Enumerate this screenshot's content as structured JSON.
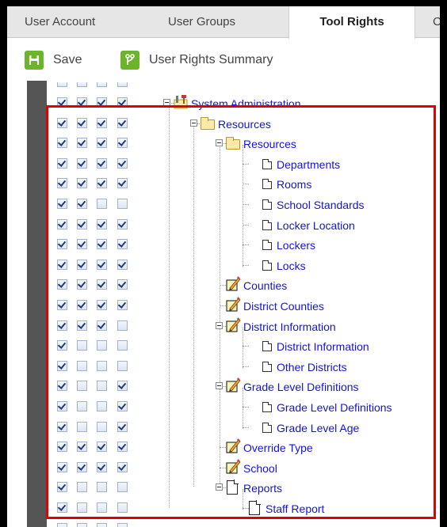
{
  "tabs": [
    {
      "label": "User Account",
      "active": false
    },
    {
      "label": "User Groups",
      "active": false
    },
    {
      "label": "Tool Rights",
      "active": true
    },
    {
      "label": "C",
      "active": false
    }
  ],
  "toolbar": {
    "save_label": "Save",
    "save_icon": "save-icon",
    "summary_label": "User Rights Summary",
    "summary_icon": "branch-icon"
  },
  "tree": [
    {
      "label": "System Administration",
      "icon": "tools-icon",
      "checks": [
        true,
        true,
        true,
        true
      ]
    },
    {
      "label": "Resources",
      "icon": "folder-icon",
      "checks": [
        true,
        true,
        true,
        true
      ]
    },
    {
      "label": "Resources",
      "icon": "folder-open-icon",
      "checks": [
        true,
        true,
        true,
        true
      ]
    },
    {
      "label": "Departments",
      "icon": "page-icon",
      "checks": [
        true,
        true,
        true,
        true
      ]
    },
    {
      "label": "Rooms",
      "icon": "page-icon",
      "checks": [
        true,
        true,
        true,
        true
      ]
    },
    {
      "label": "School Standards",
      "icon": "page-icon",
      "checks": [
        true,
        true,
        false,
        false
      ]
    },
    {
      "label": "Locker Location",
      "icon": "page-icon",
      "checks": [
        true,
        true,
        true,
        true
      ]
    },
    {
      "label": "Lockers",
      "icon": "page-icon",
      "checks": [
        true,
        true,
        true,
        true
      ]
    },
    {
      "label": "Locks",
      "icon": "page-icon",
      "checks": [
        true,
        true,
        true,
        true
      ]
    },
    {
      "label": "Counties",
      "icon": "notepad-icon",
      "checks": [
        true,
        true,
        true,
        true
      ]
    },
    {
      "label": "District Counties",
      "icon": "notepad-icon",
      "checks": [
        true,
        true,
        true,
        true
      ]
    },
    {
      "label": "District Information",
      "icon": "notepad-icon",
      "checks": [
        true,
        true,
        true,
        false
      ]
    },
    {
      "label": "District Information",
      "icon": "page-icon",
      "checks": [
        true,
        false,
        false,
        false
      ]
    },
    {
      "label": "Other Districts",
      "icon": "page-icon",
      "checks": [
        true,
        false,
        false,
        false
      ]
    },
    {
      "label": "Grade Level Definitions",
      "icon": "notepad-icon",
      "checks": [
        true,
        false,
        false,
        true
      ]
    },
    {
      "label": "Grade Level Definitions",
      "icon": "page-icon",
      "checks": [
        true,
        false,
        false,
        true
      ]
    },
    {
      "label": "Grade Level Age",
      "icon": "page-icon",
      "checks": [
        true,
        false,
        false,
        true
      ]
    },
    {
      "label": "Override Type",
      "icon": "notepad-icon",
      "checks": [
        true,
        true,
        true,
        true
      ]
    },
    {
      "label": "School",
      "icon": "notepad-icon",
      "checks": [
        true,
        true,
        true,
        true
      ]
    },
    {
      "label": "Reports",
      "icon": "document-icon",
      "checks": [
        true,
        false,
        false,
        false
      ]
    },
    {
      "label": "Staff Report",
      "icon": "document-icon",
      "checks": [
        true,
        false,
        false,
        false
      ]
    }
  ],
  "colors": {
    "highlight": "#e00000",
    "link": "#1414d6",
    "toolbar_icon": "#6bb52c"
  }
}
